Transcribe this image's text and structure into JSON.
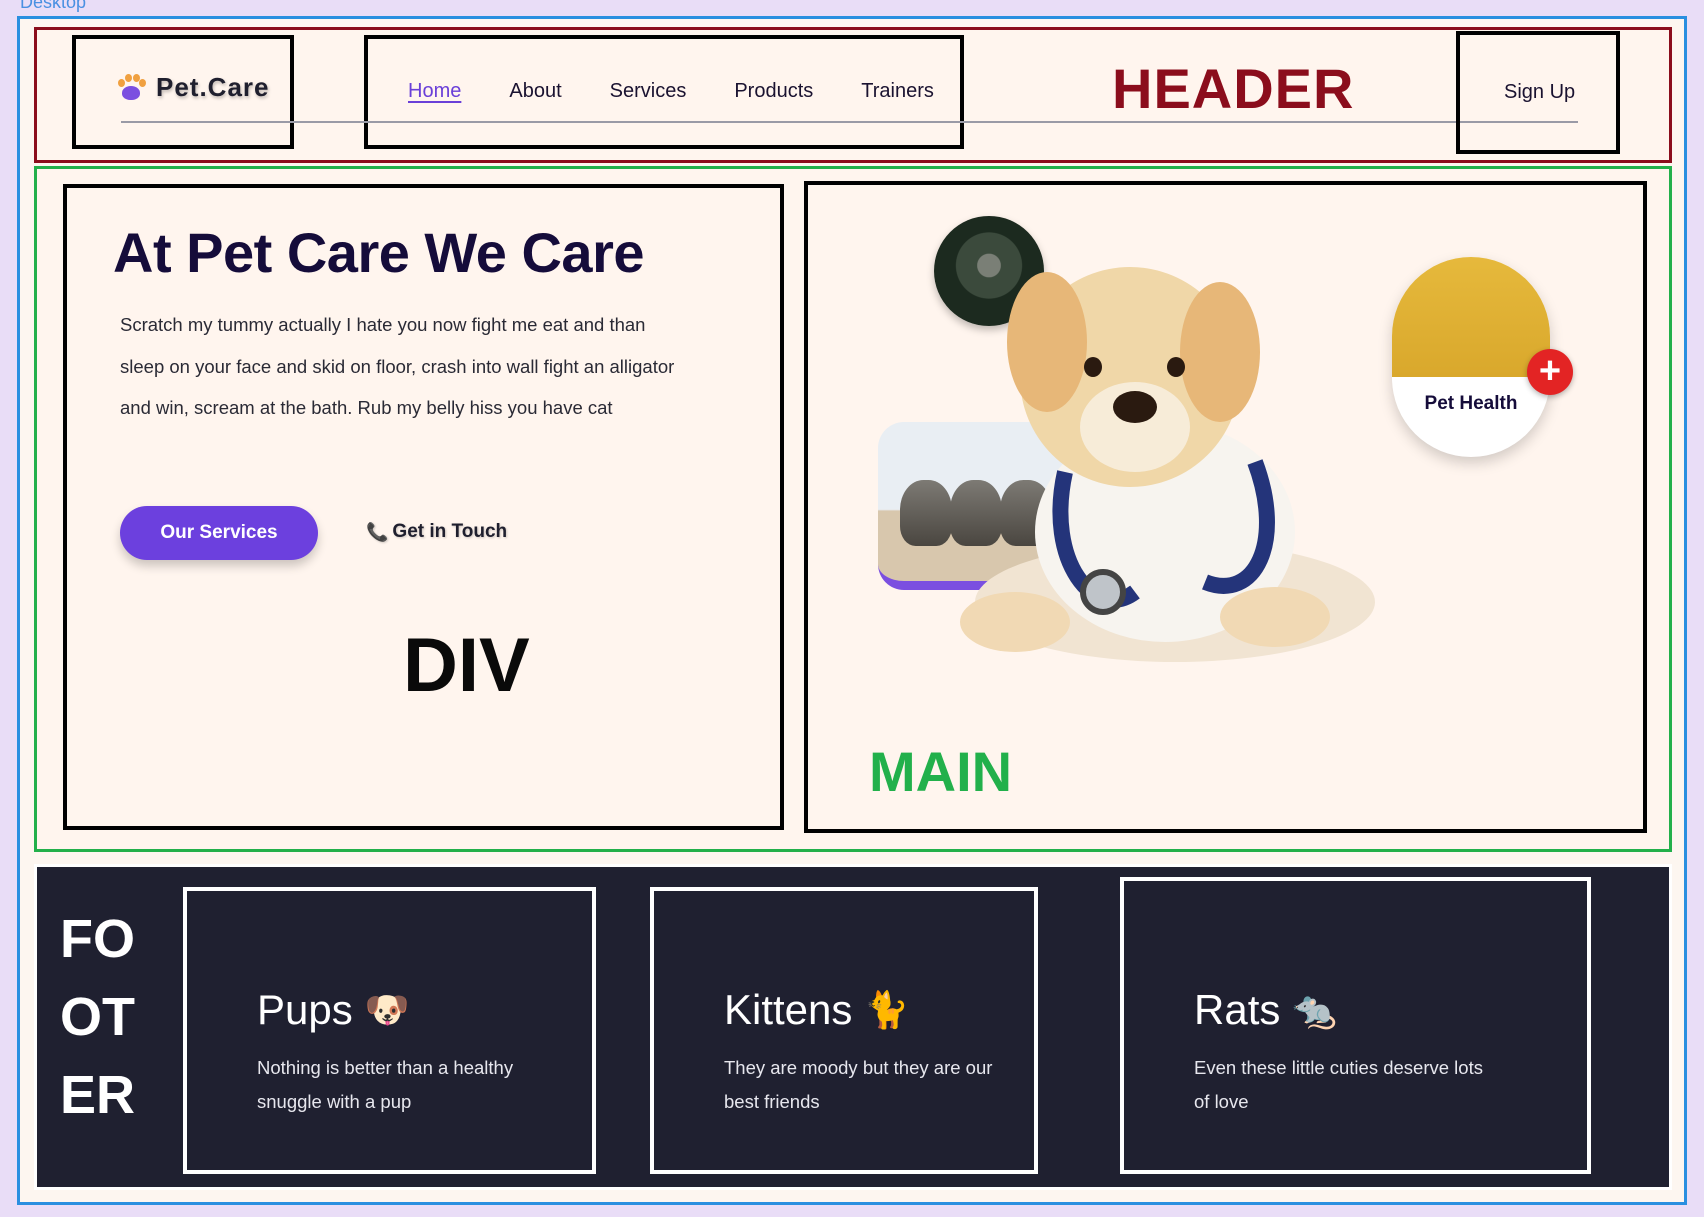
{
  "frame": {
    "label": "Desktop"
  },
  "header": {
    "logo_text": "Pet.Care",
    "nav": [
      "Home",
      "About",
      "Services",
      "Products",
      "Trainers"
    ],
    "active_nav": "Home",
    "tag": "HEADER",
    "signup_label": "Sign Up"
  },
  "main": {
    "hero_title": "At Pet Care We Care",
    "hero_text": "Scratch my tummy actually I hate you now fight me eat and than sleep on your face and skid on floor, crash into wall fight an alligator and win, scream at the bath. Rub my belly hiss you have cat",
    "primary_button": "Our Services",
    "secondary_button": "Get in Touch",
    "div_tag": "DIV",
    "main_tag": "MAIN",
    "pet_health_label": "Pet Health",
    "plus_symbol": "+"
  },
  "footer": {
    "tag_lines": [
      "FO",
      "OT",
      "ER"
    ],
    "cards": [
      {
        "title": "Pups",
        "emoji": "🐶",
        "desc": "Nothing is better than a healthy snuggle with a pup"
      },
      {
        "title": "Kittens",
        "emoji": "🐈",
        "desc": "They are moody but they are our best friends"
      },
      {
        "title": "Rats",
        "emoji": "🐀",
        "desc": "Even these little cuties deserve lots of love"
      }
    ]
  },
  "colors": {
    "header_border": "#8b0d1c",
    "main_border": "#22b04b",
    "frame_border": "#2a8fe0",
    "accent": "#6c40de",
    "footer_bg": "#1f2030"
  }
}
